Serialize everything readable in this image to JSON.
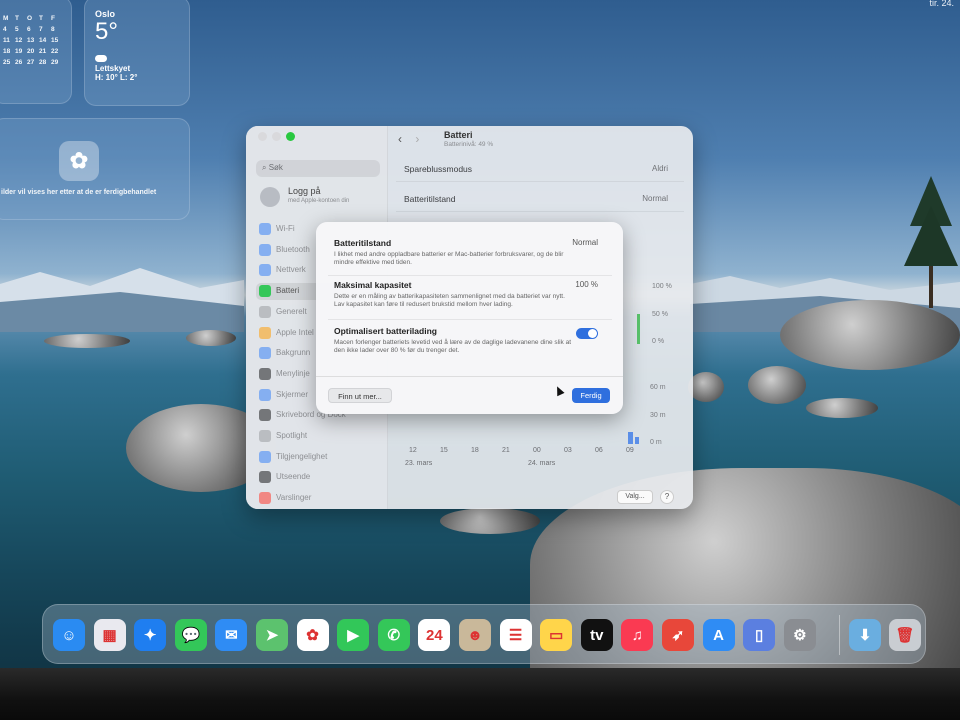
{
  "topbar": {
    "clock_fragment": "tir. 24."
  },
  "widgets": {
    "calendar_days": [
      "M",
      "T",
      "O",
      "T",
      "F",
      "4",
      "5",
      "6",
      "7",
      "8",
      "11",
      "12",
      "13",
      "14",
      "15",
      "18",
      "19",
      "20",
      "21",
      "22",
      "25",
      "26",
      "27",
      "28",
      "29"
    ],
    "weather": {
      "city": "Oslo",
      "temp": "5°",
      "condition": "Lettskyet",
      "hilo": "H: 10° L: 2°"
    },
    "photos": {
      "text": "ilder vil vises her etter at de er ferdigbehandlet"
    }
  },
  "settings": {
    "search_placeholder": "Søk",
    "login": {
      "title": "Logg på",
      "subtitle": "med Apple-kontoen din"
    },
    "nav": [
      {
        "label": "Wi-Fi",
        "color": "#3a83f7"
      },
      {
        "label": "Bluetooth",
        "color": "#3a83f7"
      },
      {
        "label": "Nettverk",
        "color": "#3a83f7"
      },
      {
        "label": "Batteri",
        "color": "#35c759"
      },
      {
        "label": "Generelt",
        "color": "#9a9ca0"
      },
      {
        "label": "Apple Intel",
        "color": "#ff9f0a"
      },
      {
        "label": "Bakgrunn",
        "color": "#3a83f7"
      },
      {
        "label": "Menylinje",
        "color": "#1c1c1e"
      },
      {
        "label": "Skjermer",
        "color": "#3a83f7"
      },
      {
        "label": "Skrivebord og Dock",
        "color": "#1c1c1e"
      },
      {
        "label": "Spotlight",
        "color": "#9a9ca0"
      },
      {
        "label": "Tilgjengelighet",
        "color": "#3a83f7"
      },
      {
        "label": "Utseende",
        "color": "#1c1c1e"
      },
      {
        "label": "Varslinger",
        "color": "#ff3b30"
      }
    ],
    "header": {
      "back": "‹",
      "forward": "›",
      "title": "Batteri",
      "subtitle": "Batterinivå: 49 %"
    },
    "rows": [
      {
        "label": "Spareblussmodus",
        "value": "Aldri"
      },
      {
        "label": "Batteritilstand",
        "value": "Normal"
      }
    ],
    "chart": {
      "y_labels_top": [
        "100 %",
        "50 %",
        "0 %"
      ],
      "y_labels_bottom": [
        "60 m",
        "30 m",
        "0 m"
      ],
      "x_ticks": [
        "12",
        "15",
        "18",
        "21",
        "00",
        "03",
        "06",
        "09"
      ],
      "dates": [
        "23. mars",
        "24. mars"
      ]
    },
    "footer": {
      "options": "Valg...",
      "help": "?"
    }
  },
  "dialog": {
    "sections": [
      {
        "title": "Batteritilstand",
        "value": "Normal",
        "desc": "I likhet med andre oppladbare batterier er Mac-batterier forbruksvarer, og de blir mindre effektive med tiden."
      },
      {
        "title": "Maksimal kapasitet",
        "value": "100 %",
        "desc": "Dette er en måling av batterikapasiteten sammenlignet med da batteriet var nytt. Lav kapasitet kan føre til redusert brukstid mellom hver lading."
      },
      {
        "title": "Optimalisert batterilading",
        "desc": "Macen forlenger batteriets levetid ved å lære av de daglige ladevanene dine slik at den ikke lader over 80 % før du trenger det.",
        "toggle_on": true
      }
    ],
    "learn_more": "Finn ut mer...",
    "done": "Ferdig"
  },
  "dock": {
    "apps": [
      {
        "name": "Finder",
        "color": "#2a8bf2",
        "glyph": "☺"
      },
      {
        "name": "Launchpad",
        "color": "#e9e9ef",
        "glyph": "▦"
      },
      {
        "name": "Safari",
        "color": "#1f7ef0",
        "glyph": "✦"
      },
      {
        "name": "Messages",
        "color": "#33c759",
        "glyph": "💬"
      },
      {
        "name": "Mail",
        "color": "#2f8cf4",
        "glyph": "✉"
      },
      {
        "name": "Maps",
        "color": "#5cc26e",
        "glyph": "➤"
      },
      {
        "name": "Photos",
        "color": "#ffffff",
        "glyph": "✿"
      },
      {
        "name": "FaceTime",
        "color": "#32c759",
        "glyph": "▶"
      },
      {
        "name": "Phone",
        "color": "#34c759",
        "glyph": "✆"
      },
      {
        "name": "Calendar",
        "color": "#ffffff",
        "glyph": "24"
      },
      {
        "name": "Contacts",
        "color": "#c9b89a",
        "glyph": "☻"
      },
      {
        "name": "Reminders",
        "color": "#ffffff",
        "glyph": "☰"
      },
      {
        "name": "Notes",
        "color": "#ffd54a",
        "glyph": "▭"
      },
      {
        "name": "TV",
        "color": "#111111",
        "glyph": "tv"
      },
      {
        "name": "Music",
        "color": "#fa3a52",
        "glyph": "♫"
      },
      {
        "name": "Rocket",
        "color": "#e8473a",
        "glyph": "➶"
      },
      {
        "name": "App Store",
        "color": "#2f8cf4",
        "glyph": "A"
      },
      {
        "name": "iPhone Mirroring",
        "color": "#5b7fe0",
        "glyph": "▯"
      },
      {
        "name": "System Settings",
        "color": "#8a8d92",
        "glyph": "⚙"
      },
      {
        "name": "Downloads",
        "color": "#6aaee0",
        "glyph": "⬇"
      },
      {
        "name": "Trash",
        "color": "#c9cdd2",
        "glyph": "🗑"
      }
    ]
  }
}
